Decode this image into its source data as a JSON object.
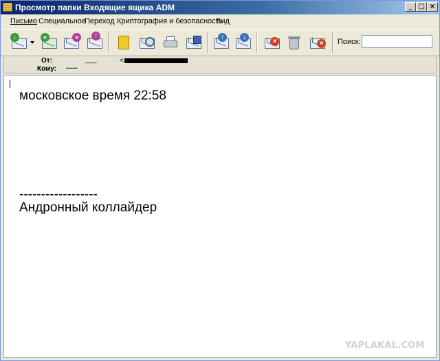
{
  "window": {
    "title": "Просмотр папки Входящие ящика ADM",
    "controls": {
      "minimize": "_",
      "maximize": "□",
      "close": "×"
    }
  },
  "menu": {
    "items": [
      "Письмо",
      "Специальное",
      "Переход",
      "Криптография и безопасность",
      "Вид"
    ]
  },
  "toolbar": {
    "buttons": [
      {
        "name": "get-mail-icon"
      },
      {
        "name": "dropdown-arrow-icon"
      },
      {
        "name": "reply-all-icon"
      },
      {
        "name": "forward-icon"
      },
      {
        "name": "send-icon"
      },
      {
        "name": "address-book-icon"
      },
      {
        "name": "find-icon"
      },
      {
        "name": "print-icon"
      },
      {
        "name": "save-icon"
      },
      {
        "name": "previous-message-icon"
      },
      {
        "name": "next-message-icon"
      },
      {
        "name": "mark-spam-icon"
      },
      {
        "name": "delete-icon"
      },
      {
        "name": "junk-icon"
      }
    ],
    "search": {
      "label": "Поиск:",
      "value": ""
    }
  },
  "header": {
    "from_label": "От:",
    "from_value": "___",
    "from_email_prefix": "<",
    "to_label": "Кому:",
    "to_value": "-----"
  },
  "body": {
    "lines": [
      "московское время 22:58",
      "------------------",
      "Андронный коллайдер"
    ]
  },
  "watermark": "YAPLAKAL.COM",
  "colors": {
    "title_gradient_start": "#0a246a",
    "title_gradient_end": "#a6caf0",
    "chrome": "#ece9d8",
    "content_bg": "#ffffff"
  }
}
